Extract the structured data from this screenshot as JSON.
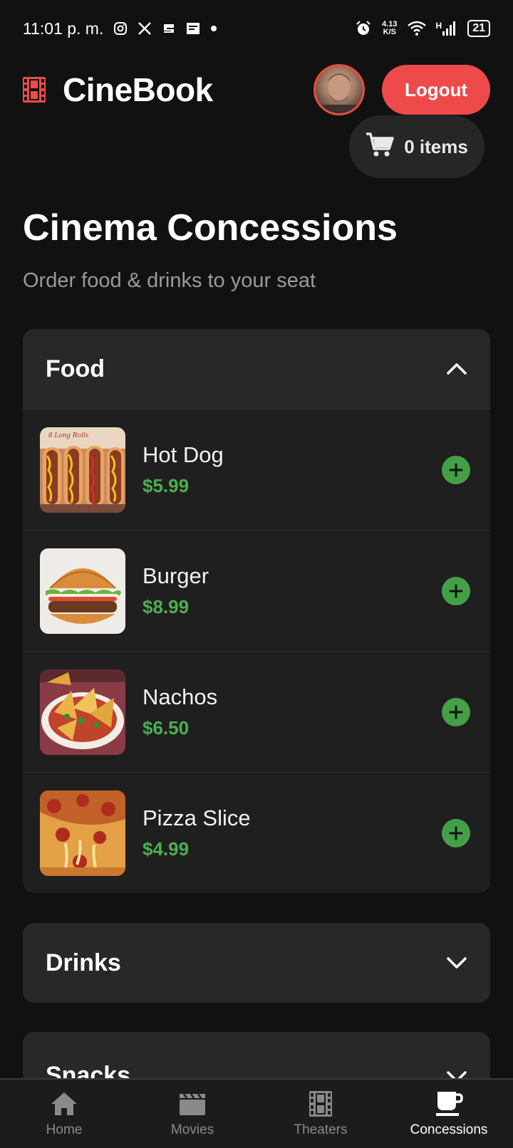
{
  "status_bar": {
    "time": "11:01 p. m.",
    "left_icons": [
      "instagram-icon",
      "x-icon",
      "app-icon",
      "news-icon",
      "dot-icon"
    ],
    "net_speed_value": "4.13",
    "net_speed_unit": "K/S",
    "network_label": "H",
    "battery": "21"
  },
  "header": {
    "brand": "CineBook",
    "logout_label": "Logout",
    "cart_label": "0 items",
    "accent_color": "#ef4a4a"
  },
  "page": {
    "title": "Cinema Concessions",
    "subtitle": "Order food & drinks to your seat"
  },
  "sections": [
    {
      "title": "Food",
      "expanded": true,
      "items": [
        {
          "name": "Hot Dog",
          "price": "$5.99",
          "thumb_label": "8 Long Rolls"
        },
        {
          "name": "Burger",
          "price": "$8.99"
        },
        {
          "name": "Nachos",
          "price": "$6.50"
        },
        {
          "name": "Pizza Slice",
          "price": "$4.99"
        }
      ]
    },
    {
      "title": "Drinks",
      "expanded": false
    },
    {
      "title": "Snacks",
      "expanded": false
    }
  ],
  "price_color": "#4caf50",
  "nav": [
    {
      "label": "Home",
      "icon": "home-icon"
    },
    {
      "label": "Movies",
      "icon": "clapperboard-icon"
    },
    {
      "label": "Theaters",
      "icon": "film-icon"
    },
    {
      "label": "Concessions",
      "icon": "coffee-cup-icon",
      "active": true
    }
  ]
}
